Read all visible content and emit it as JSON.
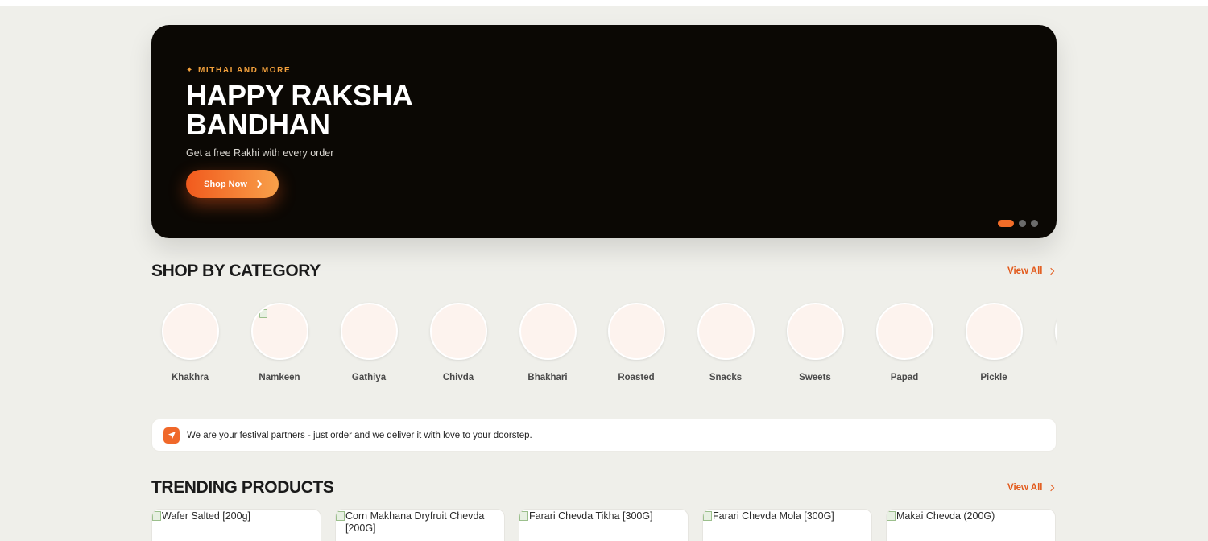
{
  "hero": {
    "eyebrow": "MITHAI AND MORE",
    "eyebrow_icon": "sparkle-icon",
    "title_line1": "HAPPY RAKSHA",
    "title_line2": "BANDHAN",
    "subtitle": "Get a free Rakhi with every order",
    "button_label": "Shop Now",
    "slides_total": 3,
    "active_slide": 1
  },
  "categories_section": {
    "title": "SHOP BY CATEGORY",
    "view_all": "View All",
    "items": [
      {
        "label": "Khakhra"
      },
      {
        "label": "Namkeen"
      },
      {
        "label": "Gathiya"
      },
      {
        "label": "Chivda"
      },
      {
        "label": "Bhakhari"
      },
      {
        "label": "Roasted"
      },
      {
        "label": "Snacks"
      },
      {
        "label": "Sweets"
      },
      {
        "label": "Papad"
      },
      {
        "label": "Pickle"
      }
    ]
  },
  "notice": {
    "icon": "send-icon",
    "text": "We are your festival partners - just order and we deliver it with love to your doorstep."
  },
  "trending": {
    "title": "TRENDING PRODUCTS",
    "view_all": "View All",
    "products": [
      {
        "alt": "Wafer Salted [200g]"
      },
      {
        "alt": "Corn Makhana Dryfruit Chevda [200G]"
      },
      {
        "alt": "Farari Chevda Tikha [300G]"
      },
      {
        "alt": "Farari Chevda Mola [300G]"
      },
      {
        "alt": "Makai Chevda (200G)"
      }
    ]
  },
  "colors": {
    "accent": "#f15a1d",
    "hero_bg": "#0b0804",
    "page_bg": "#efefea"
  }
}
